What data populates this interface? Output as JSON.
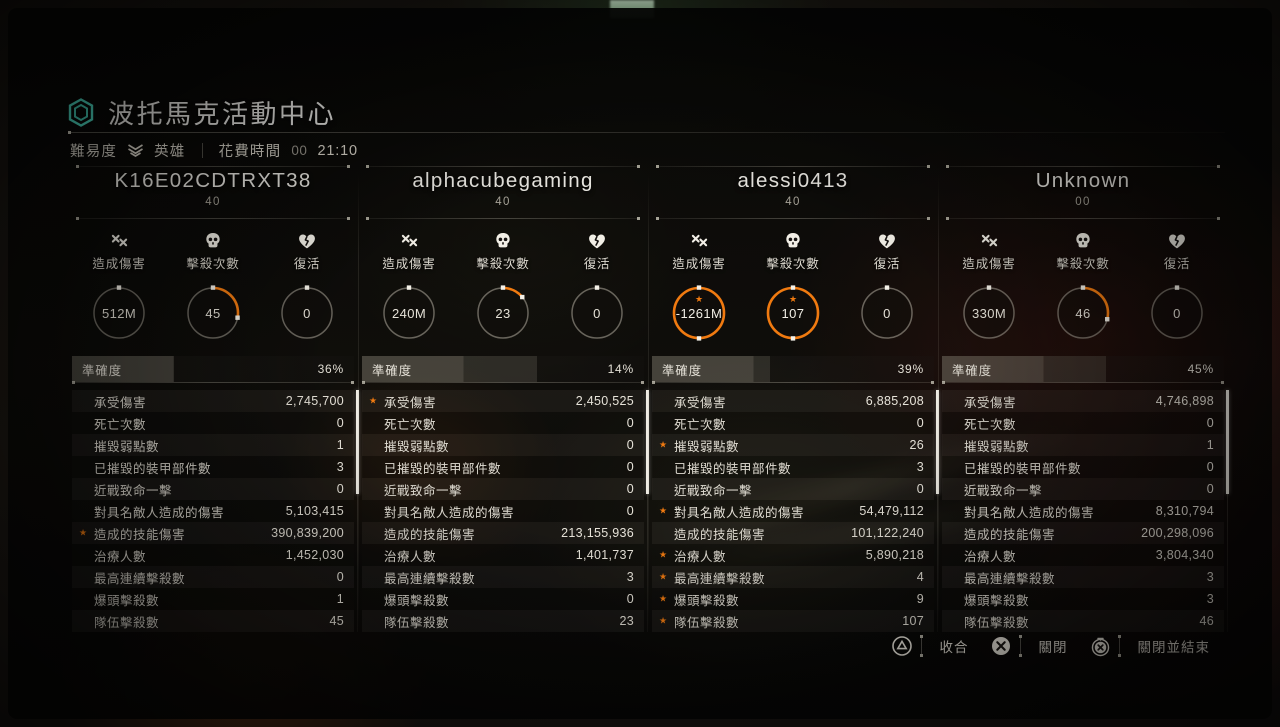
{
  "header": {
    "logo_icon": "hexagon-icon",
    "title": "波托馬克活動中心",
    "difficulty_label": "難易度",
    "difficulty_icon": "chevron-stack-icon",
    "difficulty_value": "英雄",
    "time_label": "花費時間",
    "time_prefix": "00",
    "time_value": "21:10"
  },
  "stat_icons": [
    {
      "name": "crossed-bones-icon",
      "label": "造成傷害"
    },
    {
      "name": "skull-icon",
      "label": "擊殺次數"
    },
    {
      "name": "broken-heart-icon",
      "label": "復活"
    }
  ],
  "accuracy_label": "準確度",
  "row_labels": [
    "承受傷害",
    "死亡次數",
    "摧毀弱點數",
    "已摧毀的裝甲部件數",
    "近戰致命一擊",
    "對具名敵人造成的傷害",
    "造成的技能傷害",
    "治療人數",
    "最高連續擊殺數",
    "爆頭擊殺數",
    "隊伍擊殺數"
  ],
  "colors": {
    "accent_orange": "#f07a10",
    "logo_teal": "#4fe0c8",
    "text_primary": "#e6e2d8"
  },
  "players": [
    {
      "name": "K16E02CDTRXT38",
      "level": "40",
      "gauges": [
        {
          "value": "512M",
          "pct": 0,
          "highlight": false,
          "star": false
        },
        {
          "value": "45",
          "pct": 28,
          "highlight": false,
          "star": false
        },
        {
          "value": "0",
          "pct": 0,
          "highlight": false,
          "star": false
        }
      ],
      "accuracy": "36%",
      "accuracy_pct": 36,
      "values": [
        "2,745,700",
        "0",
        "1",
        "3",
        "0",
        "5,103,415",
        "390,839,200",
        "1,452,030",
        "0",
        "1",
        "45"
      ],
      "stars": [
        false,
        false,
        false,
        false,
        false,
        false,
        true,
        false,
        false,
        false,
        false
      ]
    },
    {
      "name": "alphacubegaming",
      "level": "40",
      "gauges": [
        {
          "value": "240M",
          "pct": 0,
          "highlight": false,
          "star": false
        },
        {
          "value": "23",
          "pct": 14,
          "highlight": false,
          "star": false
        },
        {
          "value": "0",
          "pct": 0,
          "highlight": false,
          "star": false
        }
      ],
      "accuracy": "14%",
      "accuracy_pct": 62,
      "values": [
        "2,450,525",
        "0",
        "0",
        "0",
        "0",
        "0",
        "213,155,936",
        "1,401,737",
        "3",
        "0",
        "23"
      ],
      "stars": [
        true,
        false,
        false,
        false,
        false,
        false,
        false,
        false,
        false,
        false,
        false
      ]
    },
    {
      "name": "alessi0413",
      "level": "40",
      "gauges": [
        {
          "value": "-1261M",
          "pct": 100,
          "highlight": true,
          "star": true
        },
        {
          "value": "107",
          "pct": 100,
          "highlight": true,
          "star": true
        },
        {
          "value": "0",
          "pct": 0,
          "highlight": false,
          "star": false
        }
      ],
      "accuracy": "39%",
      "accuracy_pct": 42,
      "values": [
        "6,885,208",
        "0",
        "26",
        "3",
        "0",
        "54,479,112",
        "101,122,240",
        "5,890,218",
        "4",
        "9",
        "107"
      ],
      "stars": [
        false,
        false,
        true,
        false,
        false,
        true,
        false,
        true,
        true,
        true,
        true
      ]
    },
    {
      "name": "Unknown",
      "level": "00",
      "gauges": [
        {
          "value": "330M",
          "pct": 0,
          "highlight": false,
          "star": false
        },
        {
          "value": "46",
          "pct": 29,
          "highlight": false,
          "star": false
        },
        {
          "value": "0",
          "pct": 0,
          "highlight": false,
          "star": false
        }
      ],
      "accuracy": "45%",
      "accuracy_pct": 58,
      "values": [
        "4,746,898",
        "0",
        "1",
        "0",
        "0",
        "8,310,794",
        "200,298,096",
        "3,804,340",
        "3",
        "3",
        "46"
      ],
      "stars": [
        false,
        false,
        false,
        false,
        false,
        false,
        false,
        false,
        false,
        false,
        false
      ]
    }
  ],
  "footer": [
    {
      "glyph": "triangle-button-icon",
      "label": "收合"
    },
    {
      "glyph": "cross-button-icon",
      "label": "關閉"
    },
    {
      "glyph": "cross-hold-button-icon",
      "label": "關閉並結束"
    }
  ]
}
